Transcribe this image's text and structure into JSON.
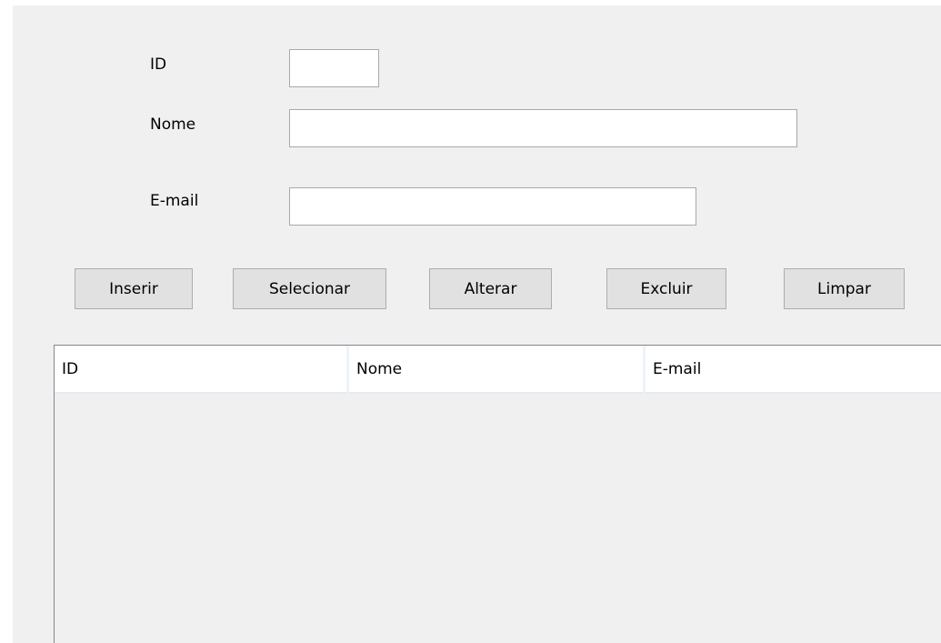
{
  "form": {
    "id_label": "ID",
    "id_value": "",
    "nome_label": "Nome",
    "nome_value": "",
    "email_label": "E-mail",
    "email_value": ""
  },
  "buttons": {
    "inserir": "Inserir",
    "selecionar": "Selecionar",
    "alterar": "Alterar",
    "excluir": "Excluir",
    "limpar": "Limpar"
  },
  "table": {
    "columns": [
      "ID",
      "Nome",
      "E-mail"
    ],
    "rows": []
  },
  "colors": {
    "window_background": "#f0f0f0",
    "button_background": "#e1e1e1",
    "field_border": "#a9a9a9"
  }
}
